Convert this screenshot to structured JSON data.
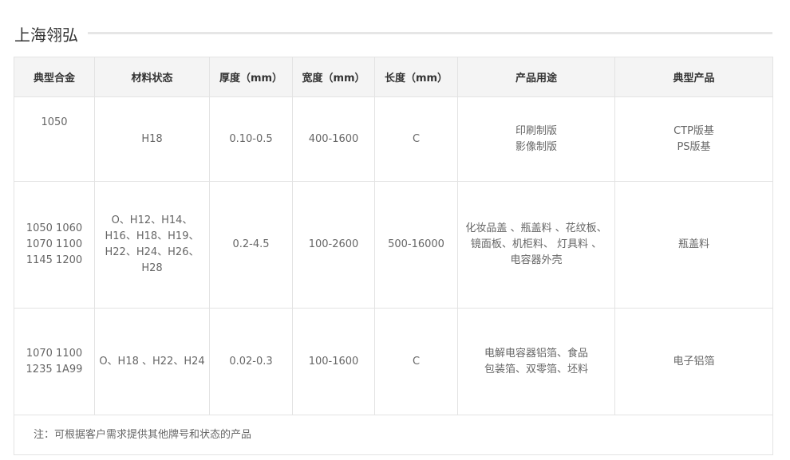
{
  "section": {
    "title": "上海翎弘"
  },
  "table": {
    "headers": [
      "典型合金",
      "材料状态",
      "厚度（mm）",
      "宽度（mm）",
      "长度（mm）",
      "产品用途",
      "典型产品"
    ],
    "rows": [
      {
        "alloy": "1050",
        "state": "H18",
        "thickness": "0.10-0.5",
        "width": "400-1600",
        "length": "C",
        "usage": "印刷制版\n影像制版",
        "product": "CTP版基\nPS版基"
      },
      {
        "alloy": "1050 1060\n1070 1100\n1145 1200",
        "state": "O、H12、H14、\nH16、H18、H19、\nH22、H24、H26、\nH28",
        "thickness": "0.2-4.5",
        "width": "100-2600",
        "length": "500-16000",
        "usage": "化妆品盖 、瓶盖料 、花纹板、\n镜面板、机柜料、 灯具料 、\n电容器外壳",
        "product": "瓶盖料"
      },
      {
        "alloy": "1070  1100\n1235 1A99",
        "state": "O、H18 、H22、H24",
        "thickness": "0.02-0.3",
        "width": "100-1600",
        "length": "C",
        "usage": "电解电容器铝箔、食品\n包装箔、双零箔、坯料",
        "product": "电子铝箔"
      }
    ],
    "note": "注：可根据客户需求提供其他牌号和状态的产品"
  }
}
